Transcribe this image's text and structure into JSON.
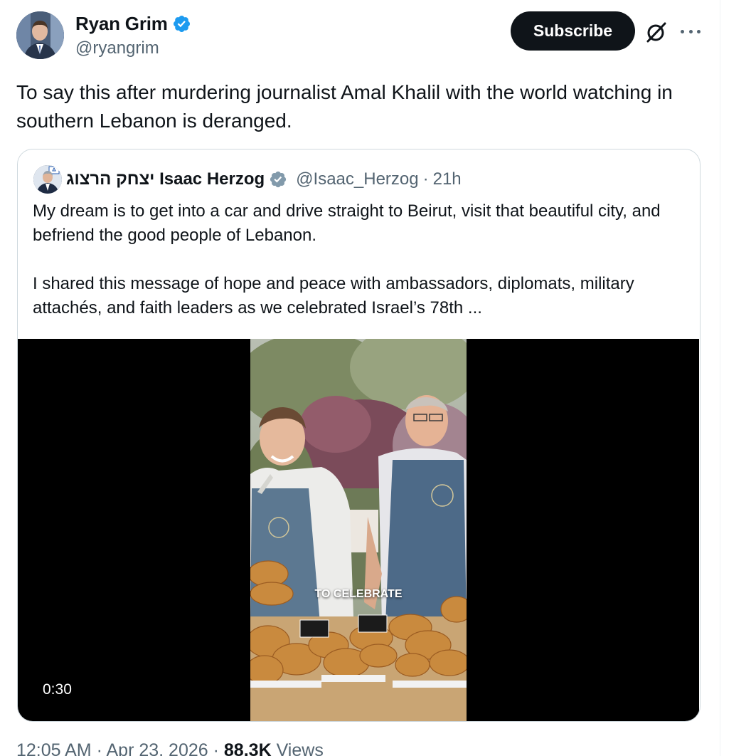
{
  "author": {
    "name": "Ryan Grim",
    "handle": "@ryangrim"
  },
  "actions": {
    "subscribe_label": "Subscribe"
  },
  "tweet": {
    "text": "To say this after murdering journalist Amal Khalil with the world watching in southern Lebanon is deranged."
  },
  "quoted": {
    "name": "יצחק הרצוג Isaac Herzog",
    "handle": "@Isaac_Herzog",
    "separator": "·",
    "time": "21h",
    "text": "My dream is to get into a car and drive straight to Beirut, visit that beautiful city, and befriend the good people of Lebanon.\n\nI shared this message of hope and peace with ambassadors, diplomats, military attachés, and faith leaders as we celebrated Israel’s 78th ...",
    "video": {
      "caption": "TO CELEBRATE",
      "duration": "0:30"
    }
  },
  "meta": {
    "time": "12:05 AM",
    "date": "Apr 23, 2026",
    "separator": "·",
    "views_count": "88.3K",
    "views_label": "Views"
  },
  "colors": {
    "verified": "#1d9bf0",
    "gray_verified": "#829aab",
    "subscribe_bg": "#0f1419",
    "secondary_text": "#536471",
    "border": "#cfd9de"
  }
}
